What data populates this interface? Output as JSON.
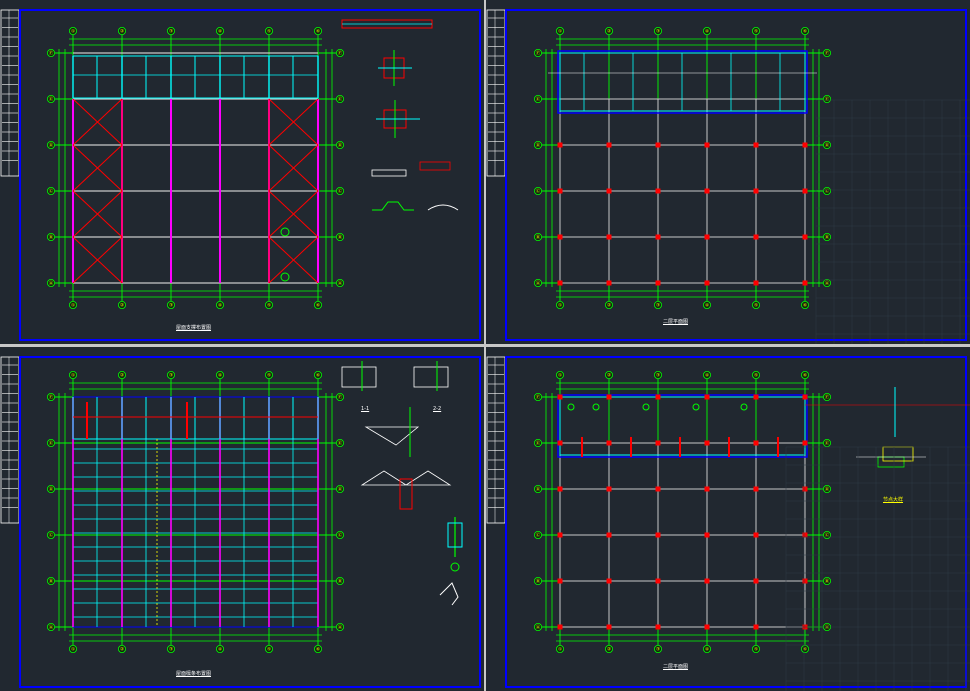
{
  "window": {
    "title": "",
    "background": "#c8c8c8"
  },
  "colors": {
    "canvas": "#212830",
    "frame": "#0000ff",
    "grid_green": "#00ff00",
    "beam_cyan": "#00ffff",
    "red": "#ff0000",
    "magenta": "#ff00ff",
    "white": "#ffffff",
    "grey_line": "#c8c8c8",
    "yellow": "#ffff00"
  },
  "grid_axes": {
    "columns": [
      "①",
      "②",
      "③",
      "④",
      "⑤",
      "⑥"
    ],
    "rows": [
      "Ⓐ",
      "Ⓑ",
      "Ⓒ",
      "Ⓓ",
      "Ⓔ",
      "Ⓕ"
    ]
  },
  "viewports": [
    {
      "id": "top-left",
      "kind": "roof-bracing-plan",
      "caption": "屋面支撑布置图"
    },
    {
      "id": "top-right",
      "kind": "floor-plan",
      "caption": "二层平面图"
    },
    {
      "id": "bottom-left",
      "kind": "purlin-layout-plan",
      "caption": "屋面檩条布置图",
      "section_labels": [
        "1-1",
        "2-2"
      ]
    },
    {
      "id": "bottom-right",
      "kind": "floor-plan",
      "caption": "二层平面图",
      "detail_caption": "节点大样"
    }
  ]
}
